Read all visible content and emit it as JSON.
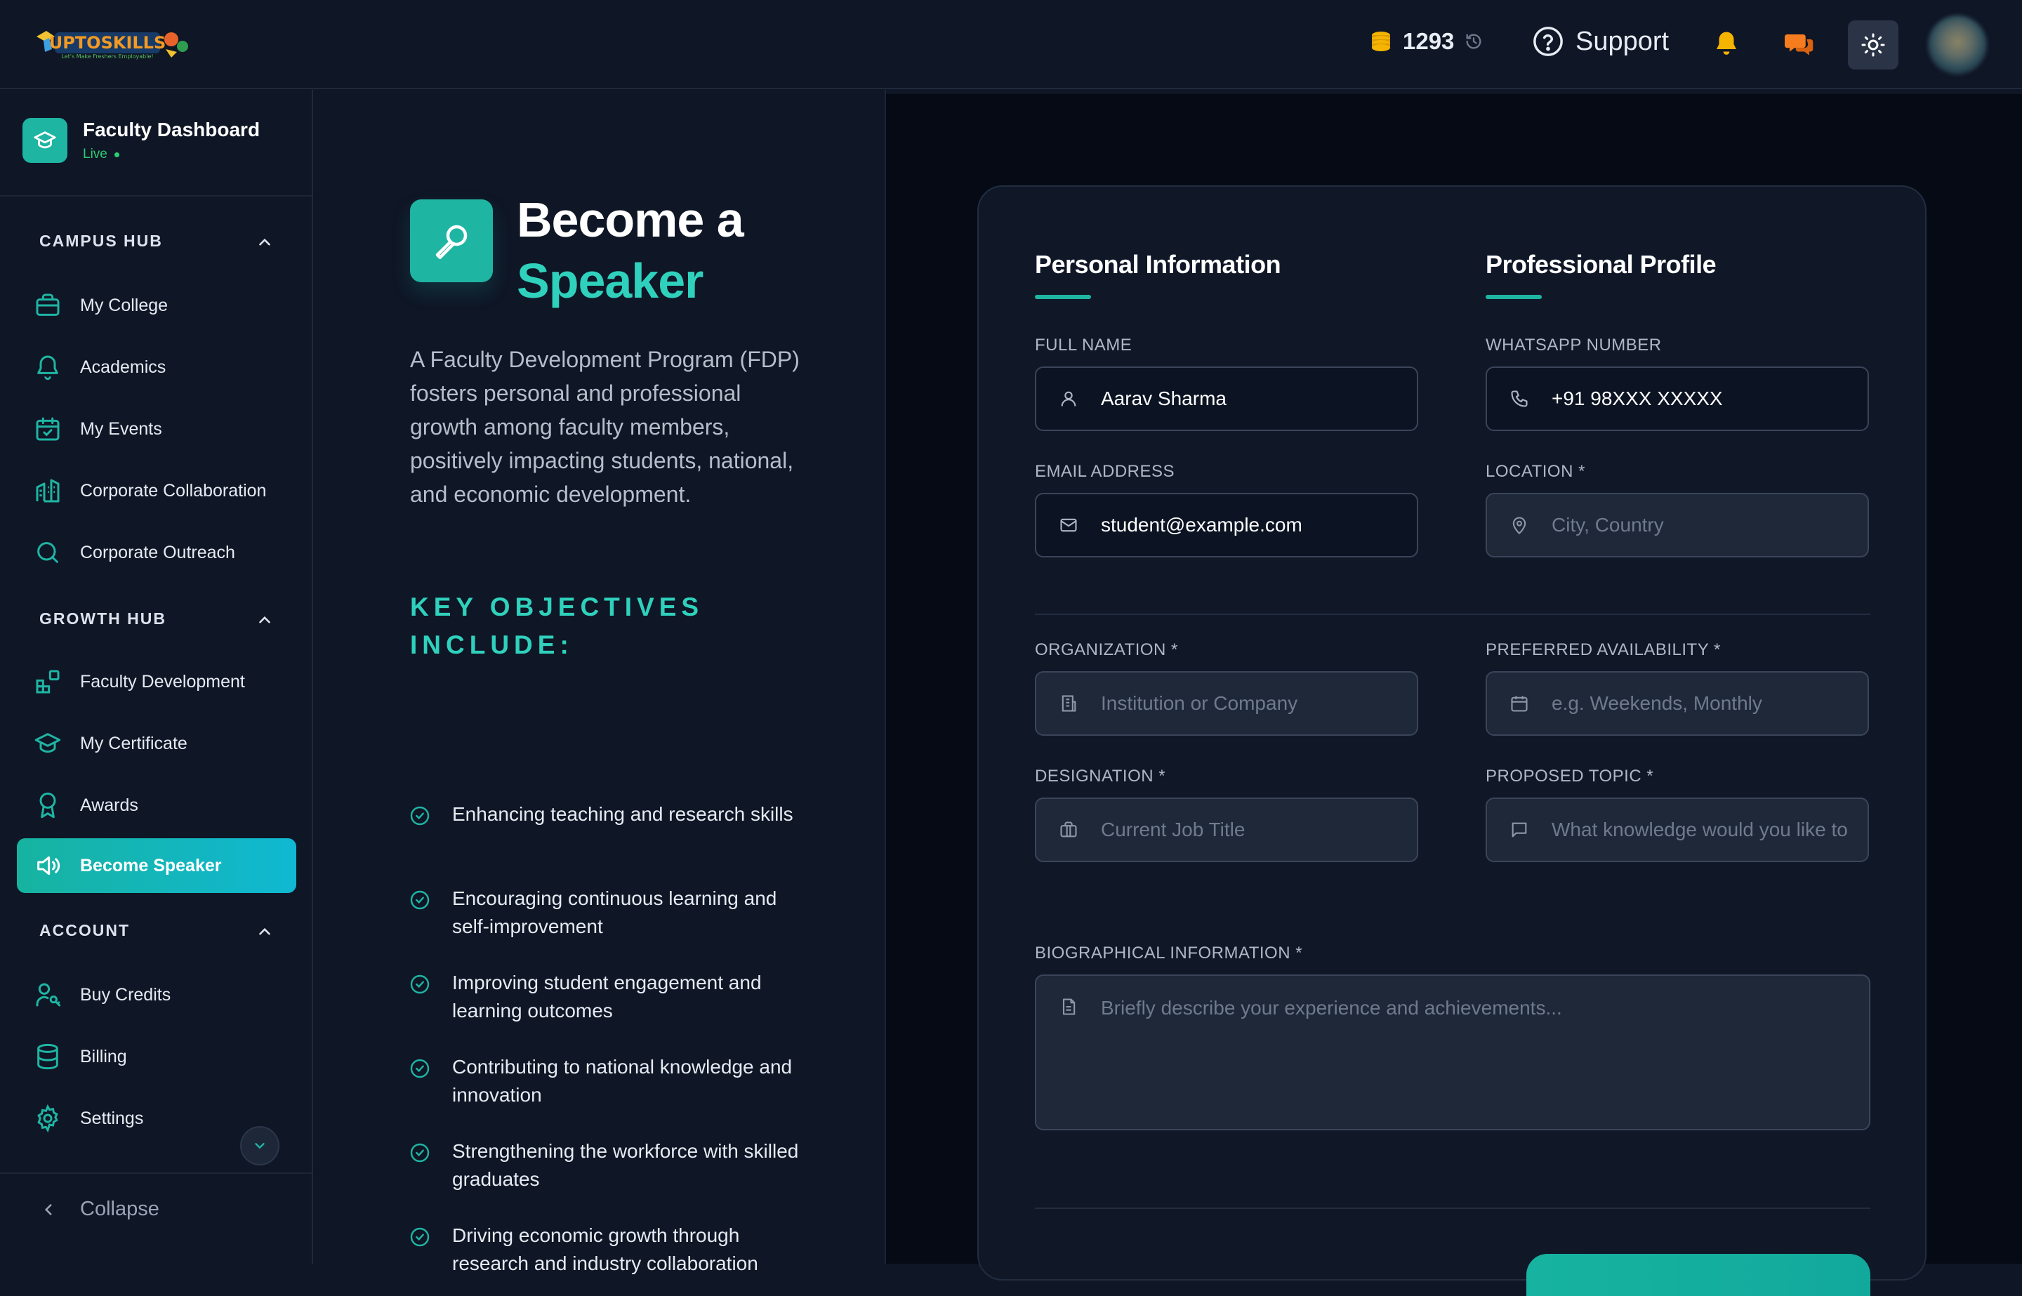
{
  "header": {
    "logo_text": "UPTOSKILLS",
    "credits": "1293",
    "support_label": "Support",
    "icons": [
      "coins-icon",
      "history-icon",
      "help-circle-icon",
      "bell-icon",
      "chat-bubbles-icon",
      "sun-icon"
    ]
  },
  "sidebar": {
    "dashboard_title": "Faculty Dashboard",
    "dashboard_status": "Live",
    "sections": [
      {
        "label": "CAMPUS HUB",
        "items": [
          {
            "label": "My College",
            "icon": "briefcase-icon"
          },
          {
            "label": "Academics",
            "icon": "bell-icon"
          },
          {
            "label": "My Events",
            "icon": "calendar-check-icon"
          },
          {
            "label": "Corporate Collaboration",
            "icon": "building-icon"
          },
          {
            "label": "Corporate Outreach",
            "icon": "search-icon"
          }
        ]
      },
      {
        "label": "GROWTH HUB",
        "items": [
          {
            "label": "Faculty Development",
            "icon": "blocks-icon"
          },
          {
            "label": "My Certificate",
            "icon": "graduation-cap-icon"
          },
          {
            "label": "Awards",
            "icon": "award-icon"
          },
          {
            "label": "Become Speaker",
            "icon": "speaker-icon"
          }
        ]
      },
      {
        "label": "ACCOUNT",
        "items": [
          {
            "label": "Buy Credits",
            "icon": "user-key-icon"
          },
          {
            "label": "Billing",
            "icon": "database-icon"
          },
          {
            "label": "Settings",
            "icon": "gear-icon"
          }
        ]
      }
    ],
    "collapse_label": "Collapse"
  },
  "intro": {
    "title_line1": "Become a",
    "title_line2": "Speaker",
    "description": "A Faculty Development Program (FDP) fosters personal and professional growth among faculty members, positively impacting students, national, and economic development.",
    "objectives_title": "KEY OBJECTIVES INCLUDE:",
    "objectives": [
      "Enhancing teaching and research skills",
      "Encouraging continuous learning and self-improvement",
      "Improving student engagement and learning outcomes",
      "Contributing to national knowledge and innovation",
      "Strengthening the workforce with skilled graduates",
      "Driving economic growth through research and industry collaboration"
    ]
  },
  "form": {
    "tab_personal": "Personal Information",
    "tab_professional": "Professional Profile",
    "full_name": {
      "label": "FULL NAME",
      "value": "Aarav Sharma"
    },
    "whatsapp": {
      "label": "WHATSAPP NUMBER",
      "value": "+91 98XXX XXXXX"
    },
    "email": {
      "label": "EMAIL ADDRESS",
      "value": "student@example.com"
    },
    "location": {
      "label": "LOCATION *",
      "placeholder": "City, Country"
    },
    "organization": {
      "label": "ORGANIZATION *",
      "placeholder": "Institution or Company"
    },
    "availability": {
      "label": "PREFERRED AVAILABILITY *",
      "placeholder": "e.g. Weekends, Monthly"
    },
    "designation": {
      "label": "DESIGNATION *",
      "placeholder": "Current Job Title"
    },
    "topic": {
      "label": "PROPOSED TOPIC *",
      "placeholder": "What knowledge would you like to share?"
    },
    "bio": {
      "label": "BIOGRAPHICAL INFORMATION *",
      "placeholder": "Briefly describe your experience and achievements..."
    }
  },
  "colors": {
    "accent": "#1fb5a3",
    "accent_text": "#2fd1bc",
    "background": "#0f1626",
    "form_background": "#050a14",
    "live": "#2ecc71",
    "bell": "#f5b400",
    "chat": "#f57c1f"
  }
}
